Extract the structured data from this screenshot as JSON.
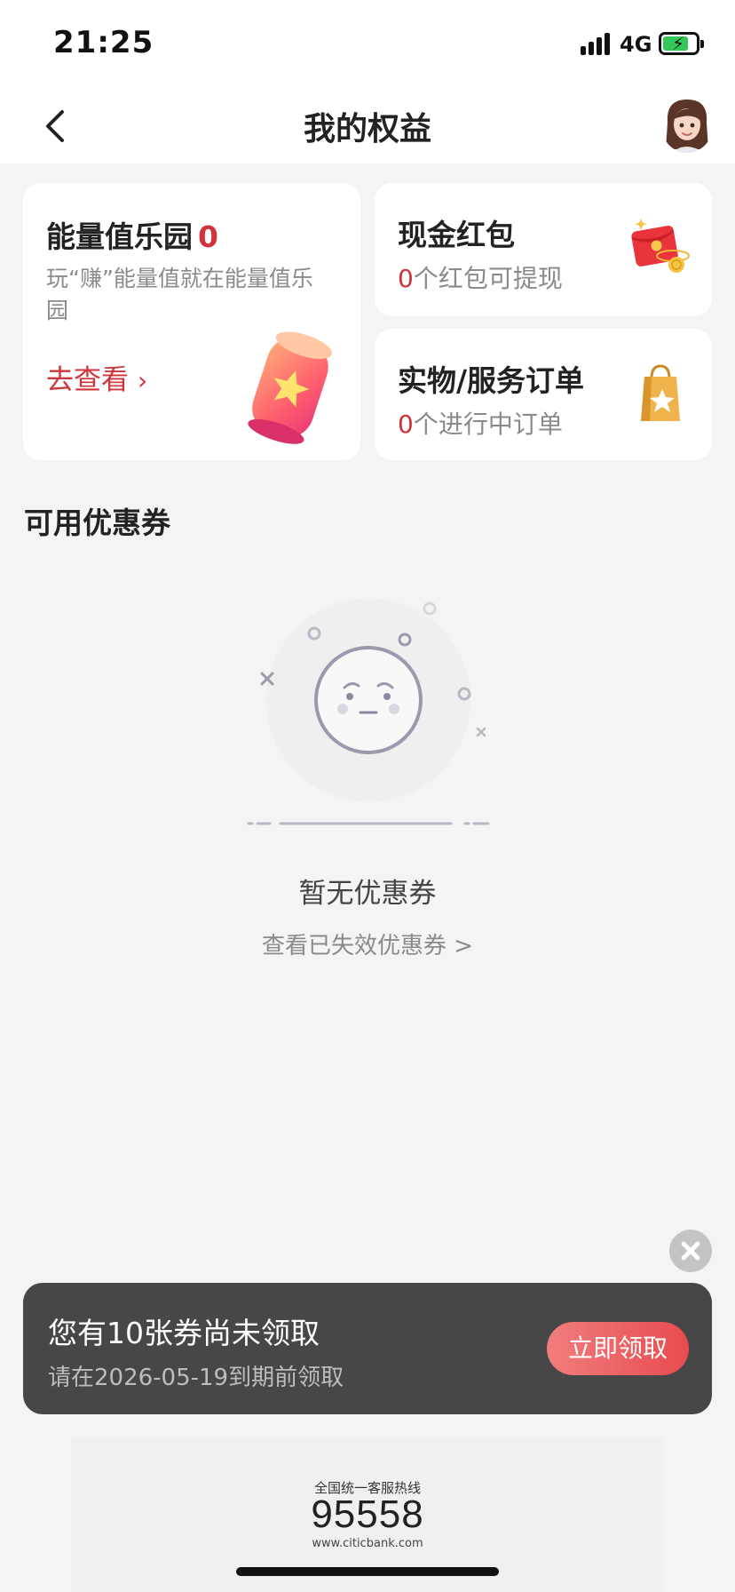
{
  "status_bar": {
    "time": "21:25",
    "network": "4G",
    "battery_charging": true
  },
  "nav": {
    "title": "我的权益"
  },
  "energy_card": {
    "title": "能量值乐园",
    "value": "0",
    "description": "玩“赚”能量值就在能量值乐园",
    "link_label": "去查看",
    "link_chevron": "›"
  },
  "redpack_card": {
    "title": "现金红包",
    "count": "0",
    "suffix": "个红包可提现"
  },
  "orders_card": {
    "title": "实物/服务订单",
    "count": "0",
    "suffix": "个进行中订单"
  },
  "coupons": {
    "section_title": "可用优惠券",
    "empty_text": "暂无优惠券",
    "expired_link": "查看已失效优惠券 >"
  },
  "coupon_banner": {
    "title": "您有10张券尚未领取",
    "subtitle": "请在2026-05-19到期前领取",
    "button_label": "立即领取"
  },
  "footer": {
    "caption": "全国统一客服热线",
    "phone": "95558",
    "url": "www.citicbank.com"
  },
  "colors": {
    "accent": "#d0343a",
    "banner_bg": "#474747",
    "button_start": "#f17d7d",
    "button_end": "#e84b4f"
  },
  "icons": [
    "back-icon",
    "avatar",
    "star-jar-icon",
    "red-envelope-icon",
    "shopping-bag-icon",
    "sad-face-icon",
    "close-icon"
  ]
}
